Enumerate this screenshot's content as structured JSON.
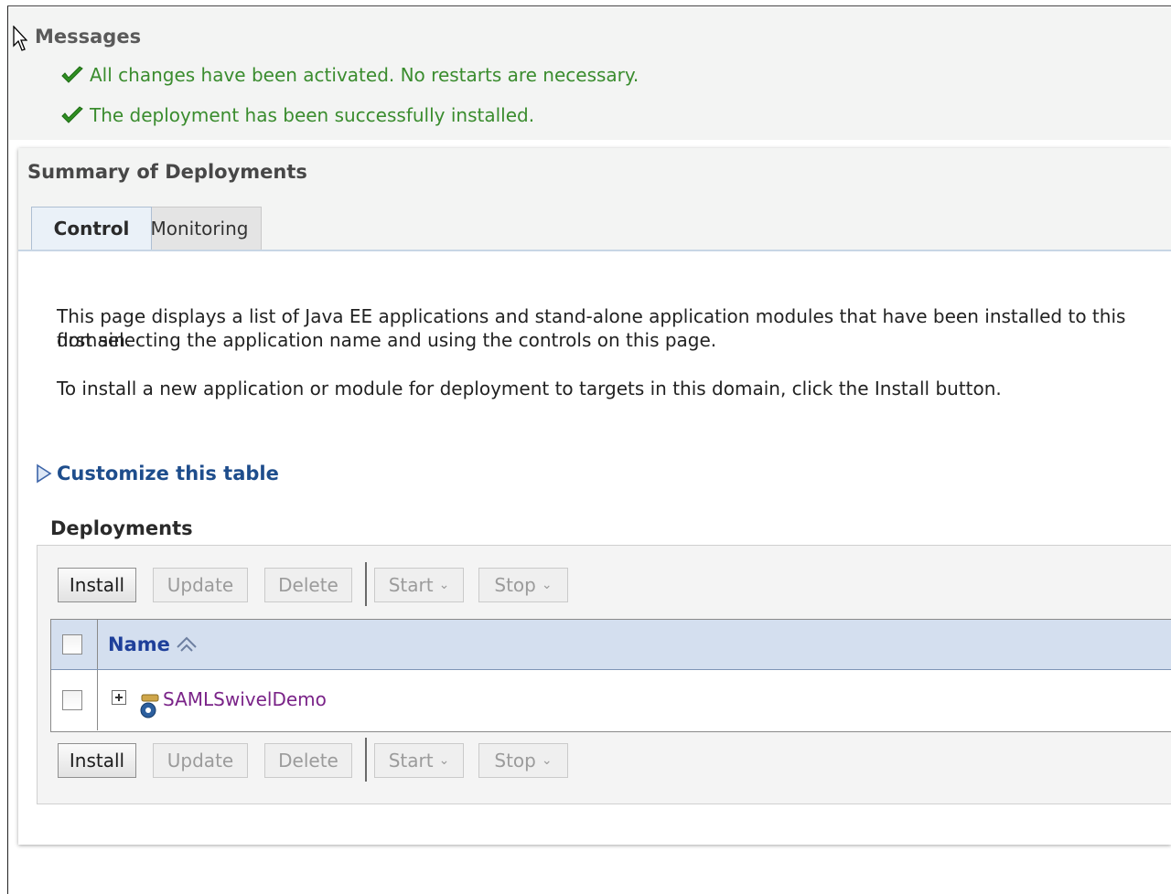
{
  "messages": {
    "title": "Messages",
    "items": [
      "All changes have been activated. No restarts are necessary.",
      "The deployment has been successfully installed."
    ]
  },
  "summary": {
    "title": "Summary of Deployments",
    "tabs": [
      "Control",
      "Monitoring"
    ],
    "active_tab": "Control",
    "description_lines": [
      "This page displays a list of Java EE applications and stand-alone application modules that have been installed to this domain.",
      "first selecting the application name and using the controls on this page.",
      "To install a new application or module for deployment to targets in this domain, click the Install button."
    ],
    "customize_link": "Customize this table"
  },
  "deployments": {
    "title": "Deployments",
    "toolbar": {
      "install": "Install",
      "update": "Update",
      "delete": "Delete",
      "start": "Start",
      "stop": "Stop"
    },
    "columns": [
      "Name"
    ],
    "rows": [
      {
        "name": "SAMLSwivelDemo"
      }
    ]
  },
  "colors": {
    "success": "#3a8c2e",
    "link": "#1e4d8c",
    "visited_link": "#7a2388",
    "table_header": "#d4dfef"
  }
}
